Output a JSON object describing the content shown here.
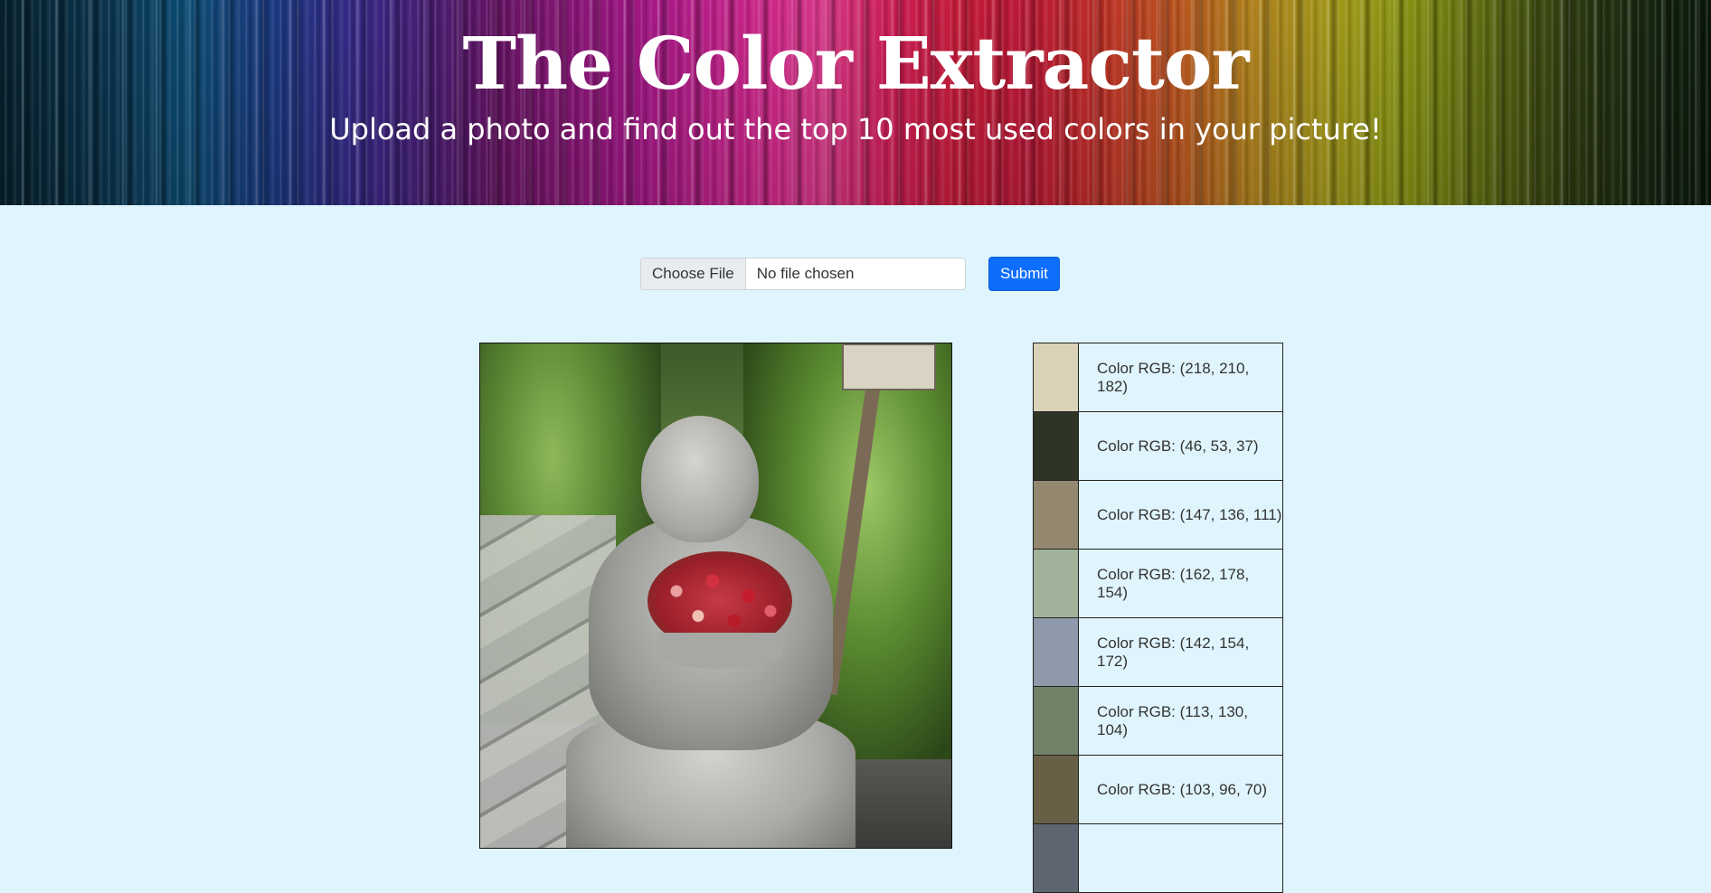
{
  "header": {
    "title": "The Color Extractor",
    "subtitle": "Upload a photo and find out the top 10 most used colors in your picture!"
  },
  "upload": {
    "choose_file_label": "Choose File",
    "file_status": "No file chosen",
    "submit_label": "Submit"
  },
  "palette": {
    "colors": [
      {
        "label": "Color RGB: (218, 210, 182)",
        "hex": "#dad2b6"
      },
      {
        "label": "Color RGB: (46, 53, 37)",
        "hex": "#2e3525"
      },
      {
        "label": "Color RGB: (147, 136, 111)",
        "hex": "#93886f"
      },
      {
        "label": "Color RGB: (162, 178, 154)",
        "hex": "#a2b29a"
      },
      {
        "label": "Color RGB: (142, 154, 172)",
        "hex": "#8e9aac"
      },
      {
        "label": "Color RGB: (113, 130, 104)",
        "hex": "#718268"
      },
      {
        "label": "Color RGB: (103, 96, 70)",
        "hex": "#676046"
      },
      {
        "label": "",
        "hex": "#5d6670"
      }
    ]
  },
  "colors": {
    "page_background": "#dff4fc",
    "submit_button": "#0d6efd"
  }
}
